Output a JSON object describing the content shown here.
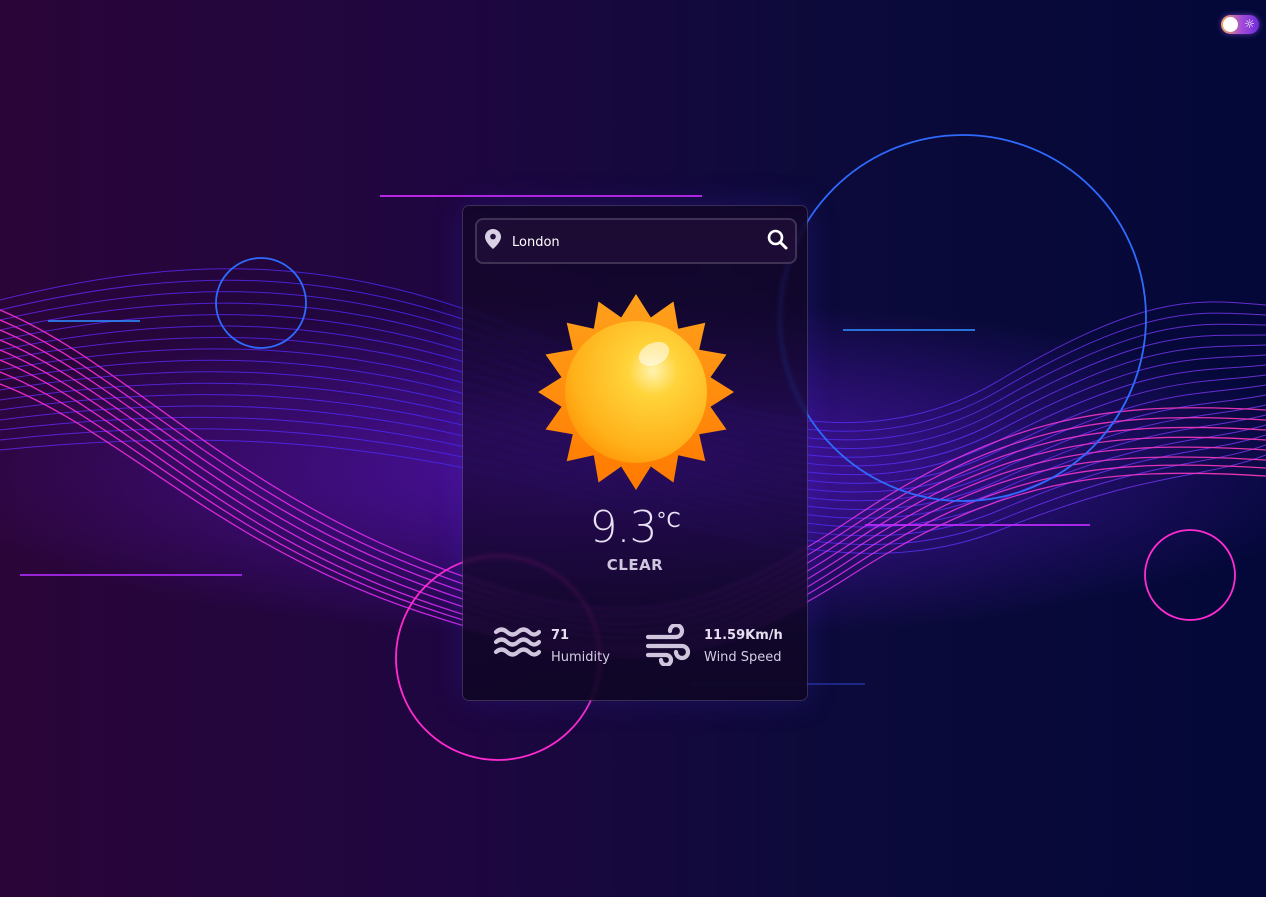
{
  "search": {
    "value": "London"
  },
  "weather": {
    "temperature": "9.3",
    "unit": "°C",
    "condition": "CLEAR"
  },
  "details": {
    "humidity": {
      "value": "71",
      "label": "Humidity"
    },
    "wind": {
      "value": "11.59Km/h",
      "label": "Wind Speed"
    }
  },
  "icons": {
    "location": "map-pin-icon",
    "search": "search-icon",
    "weather": "sun-icon",
    "humidity": "waves-icon",
    "wind": "wind-icon",
    "theme": "sun-toggle-icon"
  },
  "colors": {
    "accent_pink": "#ff2bd1",
    "accent_blue": "#2f6bff",
    "sun_orange": "#ff8a00",
    "sun_yellow": "#ffc629"
  }
}
